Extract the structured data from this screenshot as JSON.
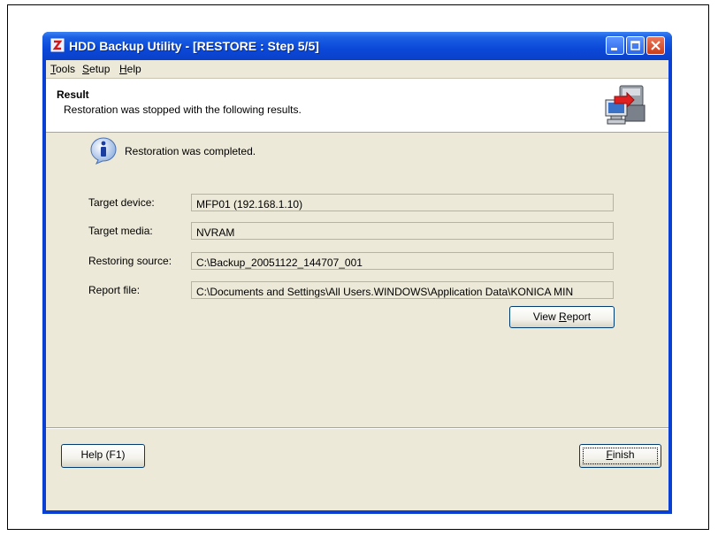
{
  "window": {
    "title": "HDD Backup Utility - [RESTORE : Step 5/5]"
  },
  "menu": {
    "items": [
      "Tools",
      "Setup",
      "Help"
    ]
  },
  "header": {
    "title": "Result",
    "subtitle": "Restoration was stopped with the following results."
  },
  "status": {
    "message": "Restoration was completed.",
    "icon": "info-icon"
  },
  "fields": [
    {
      "label": "Target device:",
      "value": "MFP01  (192.168.1.10)"
    },
    {
      "label": "Target media:",
      "value": "NVRAM"
    },
    {
      "label": "Restoring source:",
      "value": "C:\\Backup_20051122_144707_001"
    },
    {
      "label": "Report file:",
      "value": "C:\\Documents and Settings\\All Users.WINDOWS\\Application Data\\KONICA MIN"
    }
  ],
  "buttons": {
    "view_report_pre": "View ",
    "view_report_mnemonic": "R",
    "view_report_post": "eport",
    "help": "Help (F1)",
    "finish_mnemonic": "F",
    "finish_post": "inish"
  },
  "colors": {
    "titlebar": "#0b48d8",
    "dialog_bg": "#ece9d8",
    "close_button": "#c83e1b"
  }
}
